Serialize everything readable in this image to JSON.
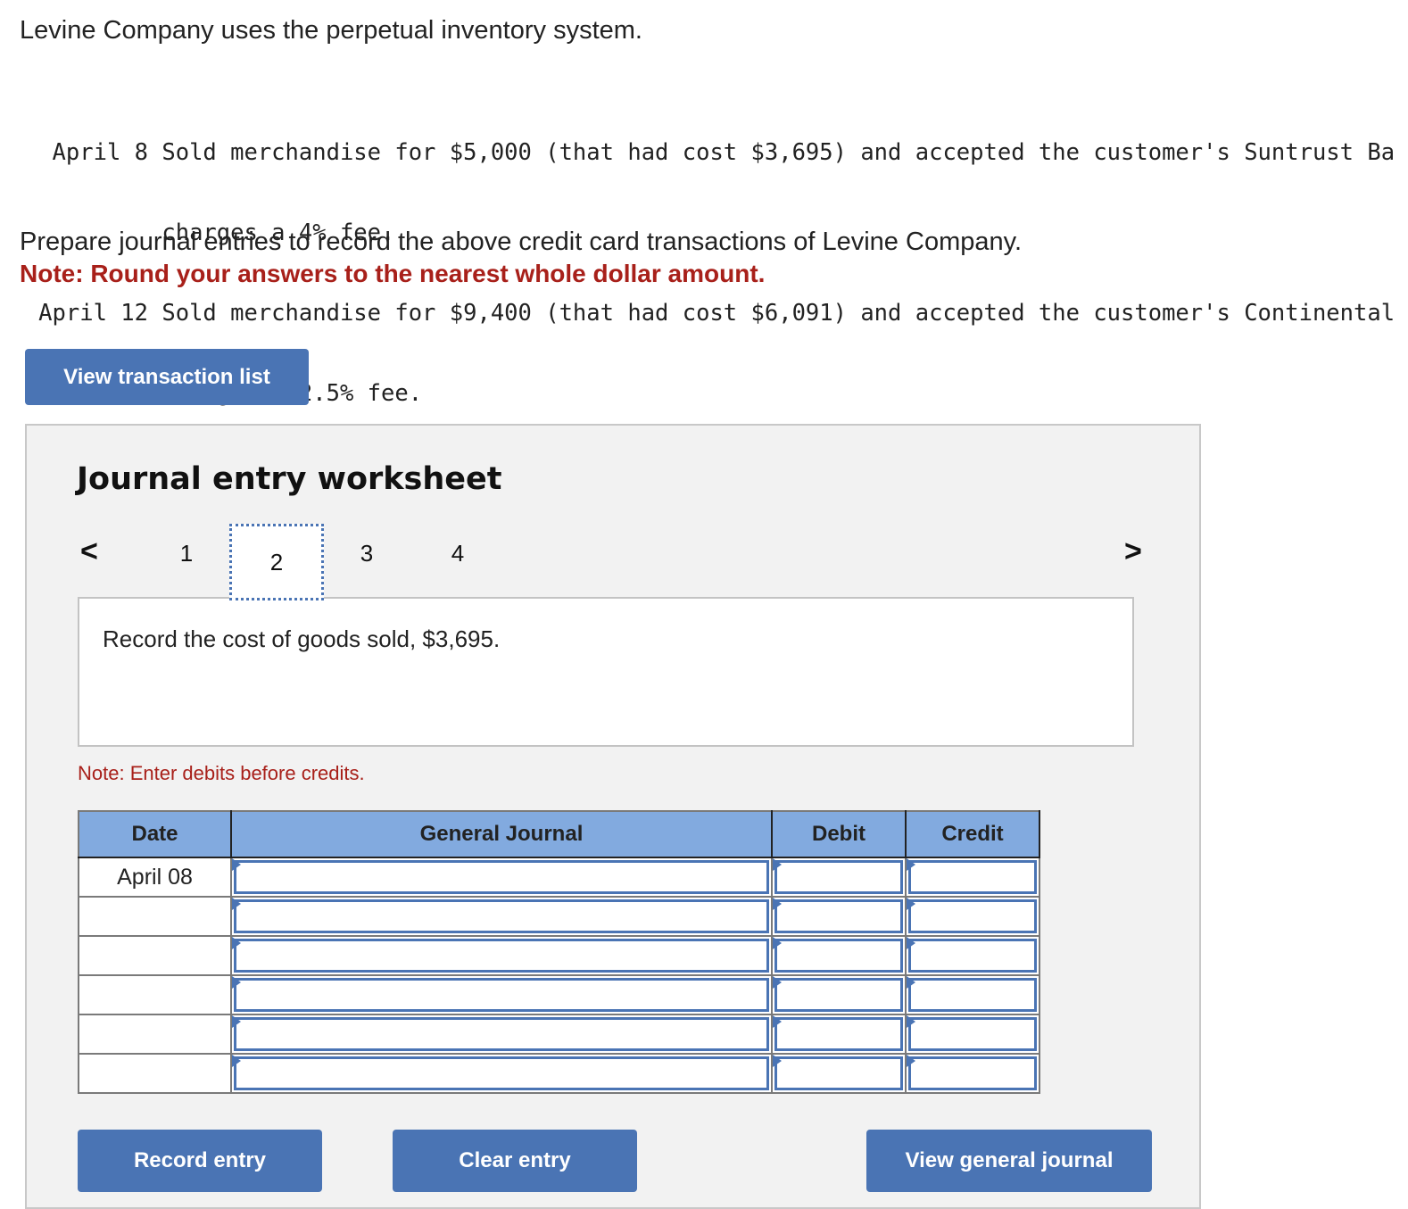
{
  "intro": "Levine Company uses the perpetual inventory system.",
  "transactions": [
    {
      "date": "April 8",
      "line1": "Sold merchandise for $5,000 (that had cost $3,695) and accepted the customer's Suntrust Ba",
      "line2": "charges a 4% fee."
    },
    {
      "date": "April 12",
      "line1": "Sold merchandise for $9,400 (that had cost $6,091) and accepted the customer's Continental",
      "line2": "charges a 2.5% fee."
    }
  ],
  "instructions": "Prepare journal entries to record the above credit card transactions of Levine Company.",
  "note_round": "Note: Round your answers to the nearest whole dollar amount.",
  "buttons": {
    "view_transaction_list": "View transaction list",
    "record_entry": "Record entry",
    "clear_entry": "Clear entry",
    "view_general_journal": "View general journal"
  },
  "worksheet": {
    "title": "Journal entry worksheet",
    "prev_icon": "chevron-left-icon",
    "next_icon": "chevron-right-icon",
    "prev_glyph": "<",
    "next_glyph": ">",
    "steps": [
      "1",
      "2",
      "3",
      "4"
    ],
    "active_step": "2",
    "description": "Record the cost of goods sold, $3,695.",
    "note_debits": "Note: Enter debits before credits."
  },
  "journal": {
    "columns": [
      "Date",
      "General Journal",
      "Debit",
      "Credit"
    ],
    "rows": [
      {
        "date": "April 08",
        "account": "",
        "debit": "",
        "credit": ""
      },
      {
        "date": "",
        "account": "",
        "debit": "",
        "credit": ""
      },
      {
        "date": "",
        "account": "",
        "debit": "",
        "credit": ""
      },
      {
        "date": "",
        "account": "",
        "debit": "",
        "credit": ""
      },
      {
        "date": "",
        "account": "",
        "debit": "",
        "credit": ""
      },
      {
        "date": "",
        "account": "",
        "debit": "",
        "credit": ""
      }
    ]
  }
}
